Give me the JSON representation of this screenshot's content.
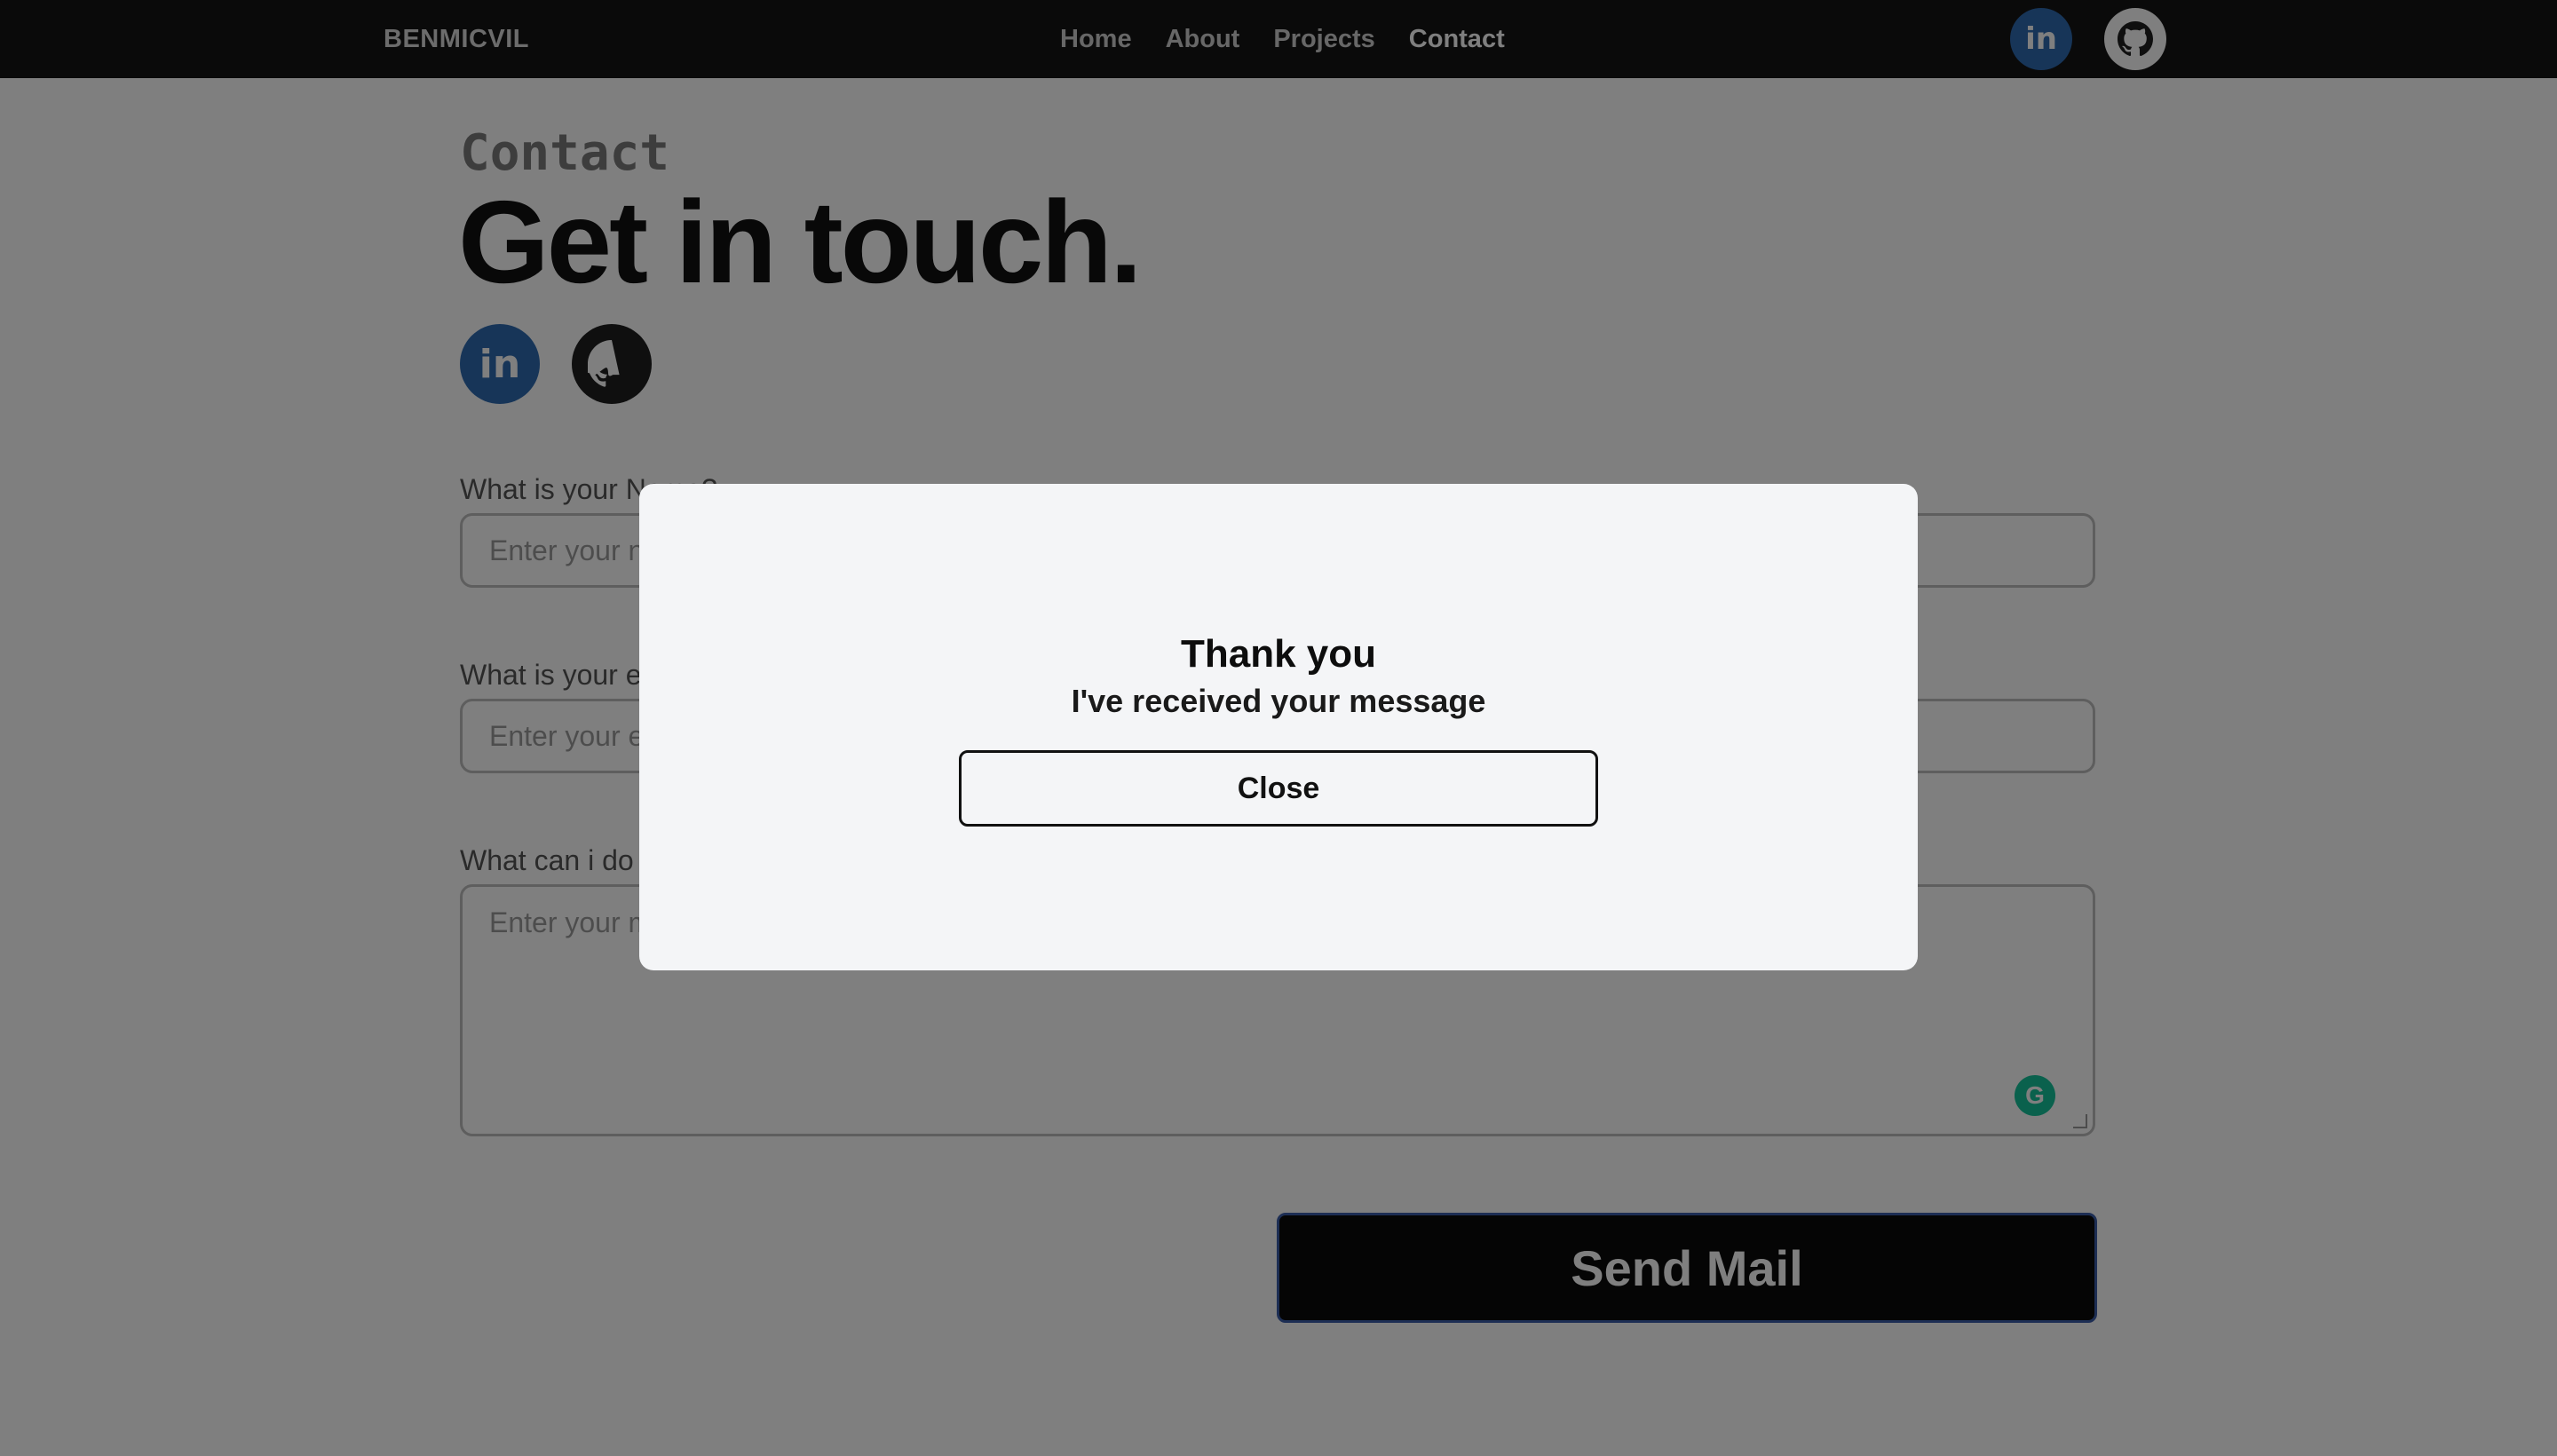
{
  "navbar": {
    "brand": "BENMICVIL",
    "links": [
      {
        "label": "Home"
      },
      {
        "label": "About"
      },
      {
        "label": "Projects"
      },
      {
        "label": "Contact"
      }
    ],
    "active_link": "Contact",
    "icons": [
      "linkedin-icon",
      "github-icon"
    ]
  },
  "page": {
    "eyebrow": "Contact",
    "headline": "Get in touch.",
    "social": {
      "linkedin_label": "in",
      "icons": [
        "linkedin-icon",
        "github-icon"
      ]
    }
  },
  "form": {
    "name": {
      "label": "What is your Name?",
      "placeholder": "Enter your name"
    },
    "email": {
      "label": "What is your email?",
      "placeholder": "Enter your email"
    },
    "message": {
      "label": "What can i do for you?",
      "placeholder": "Enter your message"
    },
    "grammarly_icon": "grammarly-icon",
    "submit_label": "Send Mail"
  },
  "modal": {
    "title": "Thank you",
    "subtitle": "I've received your message",
    "close_label": "Close"
  },
  "colors": {
    "navbar": "#141414",
    "linkedin": "#2e6ab0",
    "overlay": "rgba(0,0,0,0.5)",
    "modal_bg": "#f4f5f7",
    "button_bg": "#0b0b0b"
  }
}
